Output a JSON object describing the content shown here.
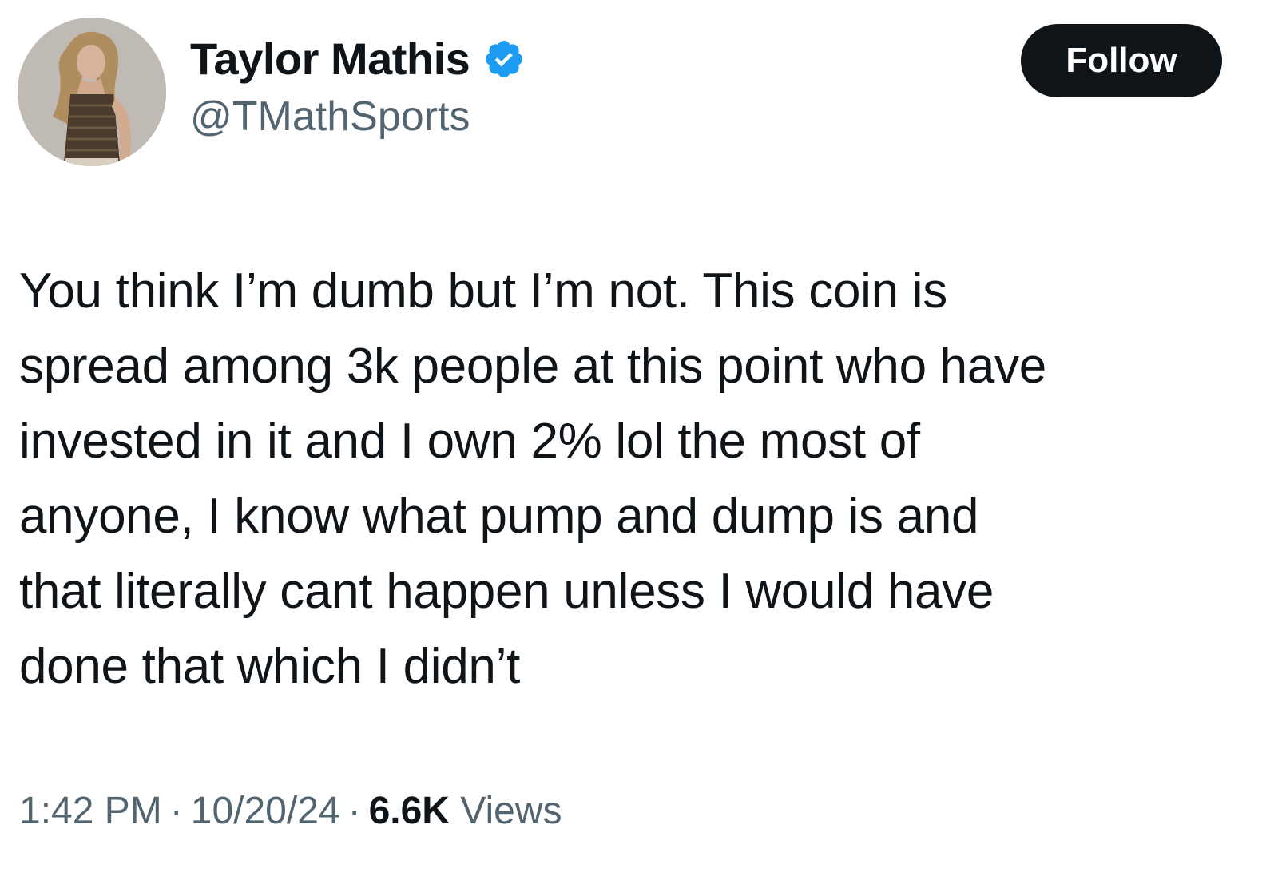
{
  "author": {
    "display_name": "Taylor Mathis",
    "handle": "@TMathSports",
    "verified": true,
    "verified_badge_color": "#1d9bf0"
  },
  "follow_button": {
    "label": "Follow"
  },
  "tweet": {
    "text": "You think I’m dumb but I’m not. This coin is\nspread among 3k people at this point who have\ninvested in it and I own 2% lol the most of\nanyone, I know what pump and dump is and\nthat literally cant happen unless I would have\ndone that which I didn’t"
  },
  "meta": {
    "time": "1:42 PM",
    "separator": "·",
    "date": "10/20/24",
    "views_count": "6.6K",
    "views_label": "Views"
  },
  "colors": {
    "text_primary": "#0f1419",
    "text_secondary": "#536471",
    "follow_bg": "#0f1419",
    "background": "#ffffff"
  },
  "icons": {
    "avatar": "profile-photo",
    "verified": "verified-badge-icon"
  }
}
